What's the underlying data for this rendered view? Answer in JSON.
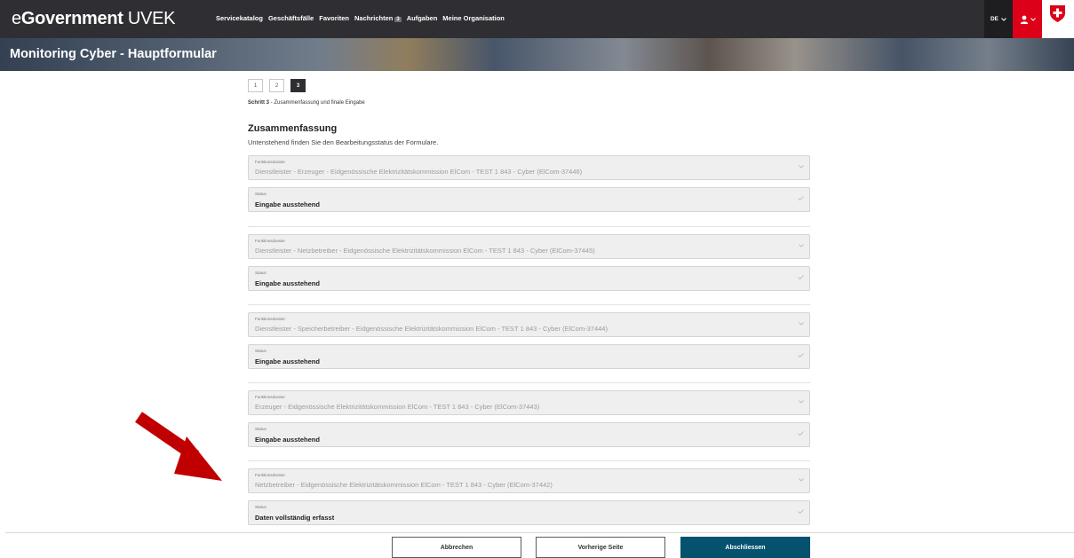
{
  "header": {
    "brand_prefix": "e",
    "brand_bold": "Government",
    "brand_suffix": "UVEK",
    "nav": [
      {
        "label": "Servicekatalog"
      },
      {
        "label": "Geschäftsfälle"
      },
      {
        "label": "Favoriten"
      },
      {
        "label": "Nachrichten",
        "badge": "3"
      },
      {
        "label": "Aufgaben"
      },
      {
        "label": "Meine Organisation"
      }
    ],
    "language": "DE",
    "accent_color": "#dc0018"
  },
  "banner": {
    "title": "Monitoring Cyber - Hauptformular"
  },
  "steps": {
    "items": [
      "1",
      "2",
      "3"
    ],
    "active": "3",
    "caption_bold": "Schritt 3",
    "caption_rest": " - Zusammenfassung und finale Eingabe"
  },
  "summary": {
    "title": "Zusammenfassung",
    "subtitle": "Untenstehend finden Sie den Bearbeitungsstatus der Formulare.",
    "entries": [
      {
        "dossier_label": "Funktionsdossier",
        "dossier_value": "Dienstleister - Erzeuger - Eidgenössische Elektrizitätskommission ElCom - TEST 1 843 - Cyber (ElCom-37446)",
        "status_label": "Status",
        "status_value": "Eingabe ausstehend"
      },
      {
        "dossier_label": "Funktionsdossier",
        "dossier_value": "Dienstleister - Netzbetreiber - Eidgenössische Elektrizitätskommission ElCom - TEST 1 843 - Cyber (ElCom-37445)",
        "status_label": "Status",
        "status_value": "Eingabe ausstehend"
      },
      {
        "dossier_label": "Funktionsdossier",
        "dossier_value": "Dienstleister - Speicherbetreiber - Eidgenössische Elektrizitätskommission ElCom - TEST 1 843 - Cyber (ElCom-37444)",
        "status_label": "Status",
        "status_value": "Eingabe ausstehend"
      },
      {
        "dossier_label": "Funktionsdossier",
        "dossier_value": "Erzeuger - Eidgenössische Elektrizitätskommission ElCom - TEST 1 843 - Cyber (ElCom-37443)",
        "status_label": "Status",
        "status_value": "Eingabe ausstehend"
      },
      {
        "dossier_label": "Funktionsdossier",
        "dossier_value": "Netzbetreiber - Eidgenössische Elektrizitätskommission ElCom - TEST 1 843 - Cyber (ElCom-37442)",
        "status_label": "Status",
        "status_value": "Daten vollständig erfasst"
      }
    ]
  },
  "footer": {
    "cancel": "Abbrechen",
    "previous": "Vorherige Seite",
    "finish": "Abschliessen",
    "primary_color": "#05526e"
  }
}
